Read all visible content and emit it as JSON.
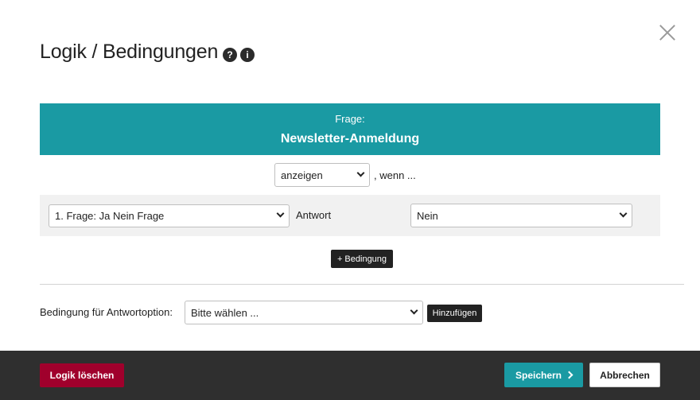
{
  "dialog": {
    "title": "Logik / Bedingungen",
    "help_icon": "question-circle-icon",
    "info_icon": "info-circle-icon",
    "close_icon": "close-icon"
  },
  "question_banner": {
    "label": "Frage:",
    "value": "Newsletter-Anmeldung",
    "color": "#1a9aa3"
  },
  "rule": {
    "action_value": "anzeigen",
    "action_options": [
      "anzeigen"
    ],
    "when_text": ", wenn ..."
  },
  "condition": {
    "question_value": "1. Frage: Ja Nein Frage",
    "answer_label": "Antwort",
    "answer_value": "Nein",
    "add_button": "+ Bedingung"
  },
  "answer_option": {
    "label": "Bedingung für Antwortoption:",
    "select_value": "Bitte wählen ...",
    "add_button": "Hinzufügen"
  },
  "footer": {
    "delete_button": "Logik löschen",
    "save_button": "Speichern",
    "cancel_button": "Abbrechen",
    "delete_color": "#a0002c",
    "save_color": "#1a9aa3"
  }
}
